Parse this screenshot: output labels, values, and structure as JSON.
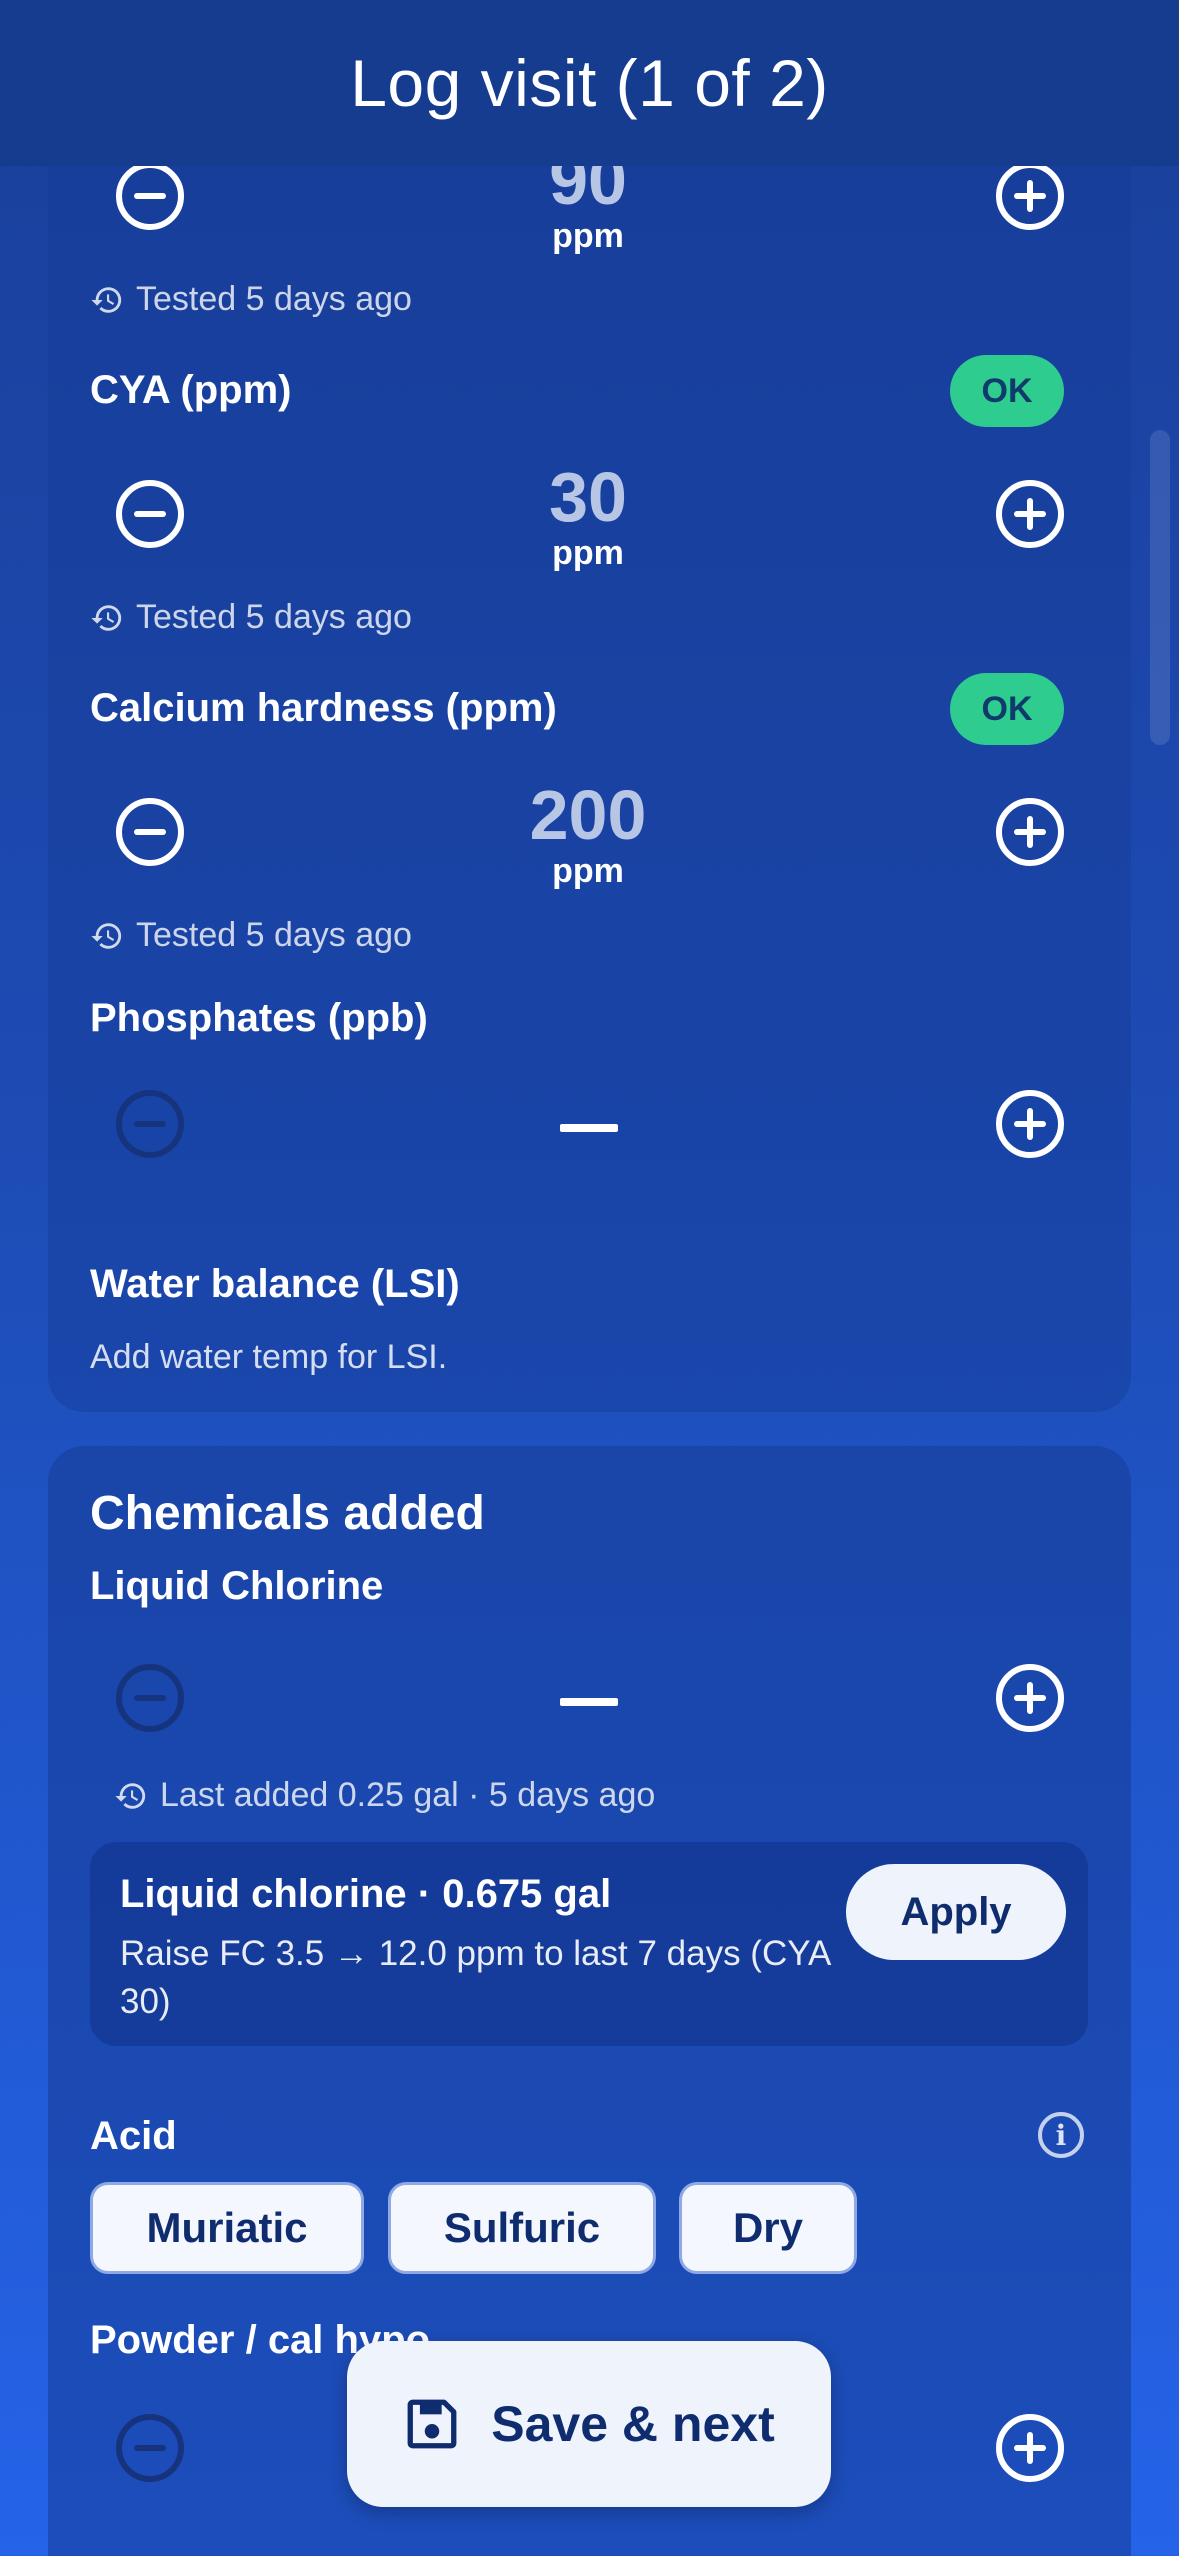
{
  "header": {
    "title": "Log visit (1 of 2)"
  },
  "colors": {
    "ok_badge": "#2ecc8f",
    "accent": "#2563e8",
    "header_bg": "#163c8f"
  },
  "readings": {
    "top_partial": {
      "value": "90",
      "unit": "ppm",
      "hint": "Tested 5 days ago"
    },
    "cya": {
      "label": "CYA (ppm)",
      "status": "OK",
      "value": "30",
      "unit": "ppm",
      "hint": "Tested 5 days ago"
    },
    "calcium": {
      "label": "Calcium hardness (ppm)",
      "status": "OK",
      "value": "200",
      "unit": "ppm",
      "hint": "Tested 5 days ago"
    },
    "phosphates": {
      "label": "Phosphates (ppb)"
    },
    "lsi": {
      "label": "Water balance (LSI)",
      "hint": "Add water temp for LSI."
    }
  },
  "chemicals": {
    "title": "Chemicals added",
    "liquid_chlorine": {
      "label": "Liquid Chlorine",
      "hint": "Last added 0.25 gal · 5 days ago",
      "recommendation": {
        "title": "Liquid chlorine · 0.675 gal",
        "description": "Raise FC 3.5 → 12.0 ppm to last 7 days (CYA 30)",
        "action": "Apply"
      }
    },
    "acid": {
      "label": "Acid",
      "options": [
        "Muriatic",
        "Sulfuric",
        "Dry"
      ]
    },
    "powder": {
      "label": "Powder / cal hypo"
    }
  },
  "footer": {
    "save_label": "Save & next"
  },
  "icons": {
    "history": "history-icon",
    "minus": "minus-circle-icon",
    "plus": "plus-circle-icon",
    "info": "info-icon",
    "save": "floppy-disk-icon"
  }
}
